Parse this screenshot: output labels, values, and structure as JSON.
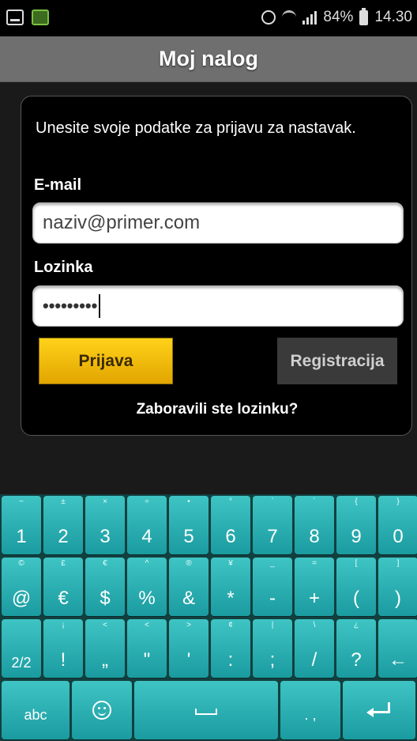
{
  "status_bar": {
    "battery_percent": "84%",
    "time": "14.30",
    "icons": [
      "screenshot-icon",
      "app-notification-icon",
      "alarm-icon",
      "wifi-icon",
      "signal-icon",
      "battery-icon"
    ]
  },
  "header": {
    "title": "Moj nalog"
  },
  "login": {
    "intro": "Unesite svoje podatke za prijavu za nastavak.",
    "email_label": "E-mail",
    "email_value": "naziv@primer.com",
    "password_label": "Lozinka",
    "password_value": "•••••••••",
    "login_button": "Prijava",
    "register_button": "Registracija",
    "forgot_link": "Zaboravili ste lozinku?"
  },
  "colors": {
    "title_bar": "#6f6f6f",
    "login_button": "#f2be0e",
    "key_color": "#2bb3b6",
    "keyboard_bg": "#12403f"
  },
  "keyboard": {
    "row1": [
      {
        "main": "1",
        "alt": "~"
      },
      {
        "main": "2",
        "alt": "±"
      },
      {
        "main": "3",
        "alt": "×"
      },
      {
        "main": "4",
        "alt": "÷"
      },
      {
        "main": "5",
        "alt": "•"
      },
      {
        "main": "6",
        "alt": "°"
      },
      {
        "main": "7",
        "alt": "`"
      },
      {
        "main": "8",
        "alt": "´"
      },
      {
        "main": "9",
        "alt": "{"
      },
      {
        "main": "0",
        "alt": "}"
      }
    ],
    "row2": [
      {
        "main": "@",
        "alt": "©"
      },
      {
        "main": "€",
        "alt": "£"
      },
      {
        "main": "$",
        "alt": "€"
      },
      {
        "main": "%",
        "alt": "^"
      },
      {
        "main": "&",
        "alt": "®"
      },
      {
        "main": "*",
        "alt": "¥"
      },
      {
        "main": "-",
        "alt": "_"
      },
      {
        "main": "+",
        "alt": "="
      },
      {
        "main": "(",
        "alt": "["
      },
      {
        "main": ")",
        "alt": "]"
      }
    ],
    "row3": [
      {
        "main": "2/2",
        "alt": ""
      },
      {
        "main": "!",
        "alt": "¡"
      },
      {
        "main": "„",
        "alt": "<"
      },
      {
        "main": "\"",
        "alt": "<"
      },
      {
        "main": "'",
        "alt": ">"
      },
      {
        "main": ":",
        "alt": "¢"
      },
      {
        "main": ";",
        "alt": "|"
      },
      {
        "main": "/",
        "alt": "\\"
      },
      {
        "main": "?",
        "alt": "¿"
      },
      {
        "main": "←",
        "alt": ""
      }
    ],
    "row4": {
      "abc": "abc",
      "emoji": "smiley-icon",
      "space": "space-icon",
      "punct": ". ,",
      "enter": "enter-icon"
    }
  }
}
